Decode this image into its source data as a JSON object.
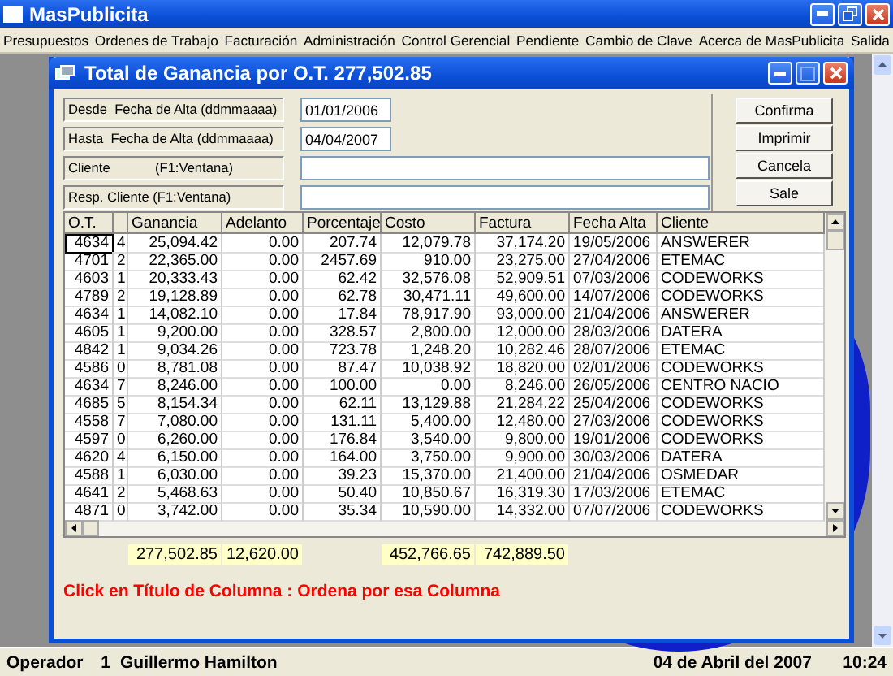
{
  "window": {
    "title": "MasPublicita"
  },
  "menu": [
    "Presupuestos",
    "Ordenes de Trabajo",
    "Facturación",
    "Administración",
    "Control Gerencial",
    "Pendiente",
    "Cambio de Clave",
    "Acerca de MasPublicita",
    "Salida"
  ],
  "child_window": {
    "title": "Total de Ganancia por O.T. 277,502.85",
    "filters": [
      {
        "label": "Desde  Fecha de Alta (ddmmaaaa)",
        "value": "01/01/2006",
        "kind": "date"
      },
      {
        "label": "Hasta  Fecha de Alta (ddmmaaaa)",
        "value": "04/04/2007",
        "kind": "date"
      },
      {
        "label": "Cliente            (F1:Ventana)",
        "kind": "text"
      },
      {
        "label": "Resp. Cliente (F1:Ventana)",
        "kind": "text"
      }
    ],
    "buttons": [
      "Confirma",
      "Imprimir",
      "Cancela",
      "Sale"
    ],
    "table": {
      "columns": [
        "O.T.",
        null,
        "Ganancia",
        "Adelanto",
        "Porcentaje",
        "Costo",
        "Factura",
        "Fecha Alta",
        "Cliente"
      ],
      "rows": [
        {
          "selected": true,
          "cells": [
            "4634",
            "4",
            "25,094.42",
            "0.00",
            "207.74",
            "12,079.78",
            "37,174.20",
            "19/05/2006",
            "ANSWERER"
          ]
        },
        {
          "selected": false,
          "cells": [
            "4701",
            "2",
            "22,365.00",
            "0.00",
            "2457.69",
            "910.00",
            "23,275.00",
            "27/04/2006",
            "ETEMAC"
          ]
        },
        {
          "selected": false,
          "cells": [
            "4603",
            "1",
            "20,333.43",
            "0.00",
            "62.42",
            "32,576.08",
            "52,909.51",
            "07/03/2006",
            "CODEWORKS"
          ]
        },
        {
          "selected": false,
          "cells": [
            "4789",
            "2",
            "19,128.89",
            "0.00",
            "62.78",
            "30,471.11",
            "49,600.00",
            "14/07/2006",
            "CODEWORKS"
          ]
        },
        {
          "selected": false,
          "cells": [
            "4634",
            "1",
            "14,082.10",
            "0.00",
            "17.84",
            "78,917.90",
            "93,000.00",
            "21/04/2006",
            "ANSWERER"
          ]
        },
        {
          "selected": false,
          "cells": [
            "4605",
            "1",
            "9,200.00",
            "0.00",
            "328.57",
            "2,800.00",
            "12,000.00",
            "28/03/2006",
            "DATERA"
          ]
        },
        {
          "selected": false,
          "cells": [
            "4842",
            "1",
            "9,034.26",
            "0.00",
            "723.78",
            "1,248.20",
            "10,282.46",
            "28/07/2006",
            "ETEMAC"
          ]
        },
        {
          "selected": false,
          "cells": [
            "4586",
            "0",
            "8,781.08",
            "0.00",
            "87.47",
            "10,038.92",
            "18,820.00",
            "02/01/2006",
            "CODEWORKS"
          ]
        },
        {
          "selected": false,
          "cells": [
            "4634",
            "7",
            "8,246.00",
            "0.00",
            "100.00",
            "0.00",
            "8,246.00",
            "26/05/2006",
            "CENTRO NACIO"
          ]
        },
        {
          "selected": false,
          "cells": [
            "4685",
            "5",
            "8,154.34",
            "0.00",
            "62.11",
            "13,129.88",
            "21,284.22",
            "25/04/2006",
            "CODEWORKS"
          ]
        },
        {
          "selected": false,
          "cells": [
            "4558",
            "7",
            "7,080.00",
            "0.00",
            "131.11",
            "5,400.00",
            "12,480.00",
            "27/03/2006",
            "CODEWORKS"
          ]
        },
        {
          "selected": false,
          "cells": [
            "4597",
            "0",
            "6,260.00",
            "0.00",
            "176.84",
            "3,540.00",
            "9,800.00",
            "19/01/2006",
            "CODEWORKS"
          ]
        },
        {
          "selected": false,
          "cells": [
            "4620",
            "4",
            "6,150.00",
            "0.00",
            "164.00",
            "3,750.00",
            "9,900.00",
            "30/03/2006",
            "DATERA"
          ]
        },
        {
          "selected": false,
          "cells": [
            "4588",
            "1",
            "6,030.00",
            "0.00",
            "39.23",
            "15,370.00",
            "21,400.00",
            "21/04/2006",
            "OSMEDAR"
          ]
        },
        {
          "selected": false,
          "cells": [
            "4641",
            "2",
            "5,468.63",
            "0.00",
            "50.40",
            "10,850.67",
            "16,319.30",
            "17/03/2006",
            "ETEMAC"
          ]
        },
        {
          "selected": false,
          "cells": [
            "4871",
            "0",
            "3,742.00",
            "0.00",
            "35.34",
            "10,590.00",
            "14,332.00",
            "07/07/2006",
            "CODEWORKS"
          ]
        }
      ]
    },
    "totals": {
      "ganancia": "277,502.85",
      "adelanto": "12,620.00",
      "costo": "452,766.65",
      "factura": "742,889.50"
    },
    "hint": "Click en Título de Columna : Ordena por esa Columna"
  },
  "status_bar": {
    "label": "Operador",
    "operator_id": "1",
    "operator_name": "Guillermo Hamilton",
    "date": "04 de Abril del 2007",
    "time": "10:24"
  }
}
